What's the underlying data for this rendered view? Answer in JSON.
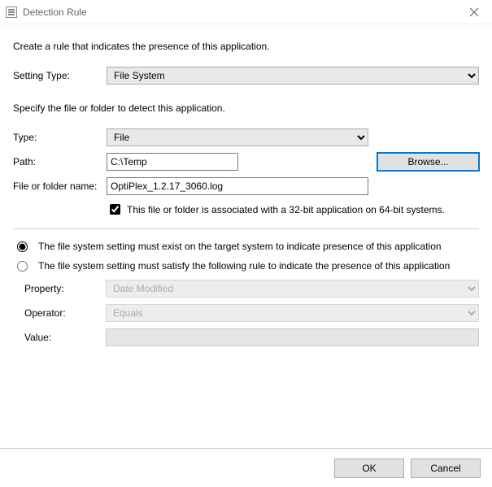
{
  "window": {
    "title": "Detection Rule",
    "close_tooltip": "Close"
  },
  "intro": "Create a rule that indicates the presence of this application.",
  "setting_type": {
    "label": "Setting Type:",
    "value": "File System"
  },
  "specify_text": "Specify the file or folder to detect this application.",
  "type": {
    "label": "Type:",
    "value": "File"
  },
  "path": {
    "label": "Path:",
    "value": "C:\\Temp",
    "browse_label": "Browse..."
  },
  "file_name": {
    "label": "File or folder name:",
    "value": "OptiPlex_1.2.17_3060.log"
  },
  "assoc32": {
    "checked": true,
    "label": "This file or folder is associated with a 32-bit application on 64-bit systems."
  },
  "radio": {
    "must_exist": "The file system setting must exist on the target system to indicate presence of this application",
    "must_satisfy": "The file system setting must satisfy the following rule to indicate the presence of this application",
    "selected": "must_exist"
  },
  "rule": {
    "property_label": "Property:",
    "property_value": "Date Modified",
    "operator_label": "Operator:",
    "operator_value": "Equals",
    "value_label": "Value:",
    "value_value": ""
  },
  "buttons": {
    "ok": "OK",
    "cancel": "Cancel"
  }
}
